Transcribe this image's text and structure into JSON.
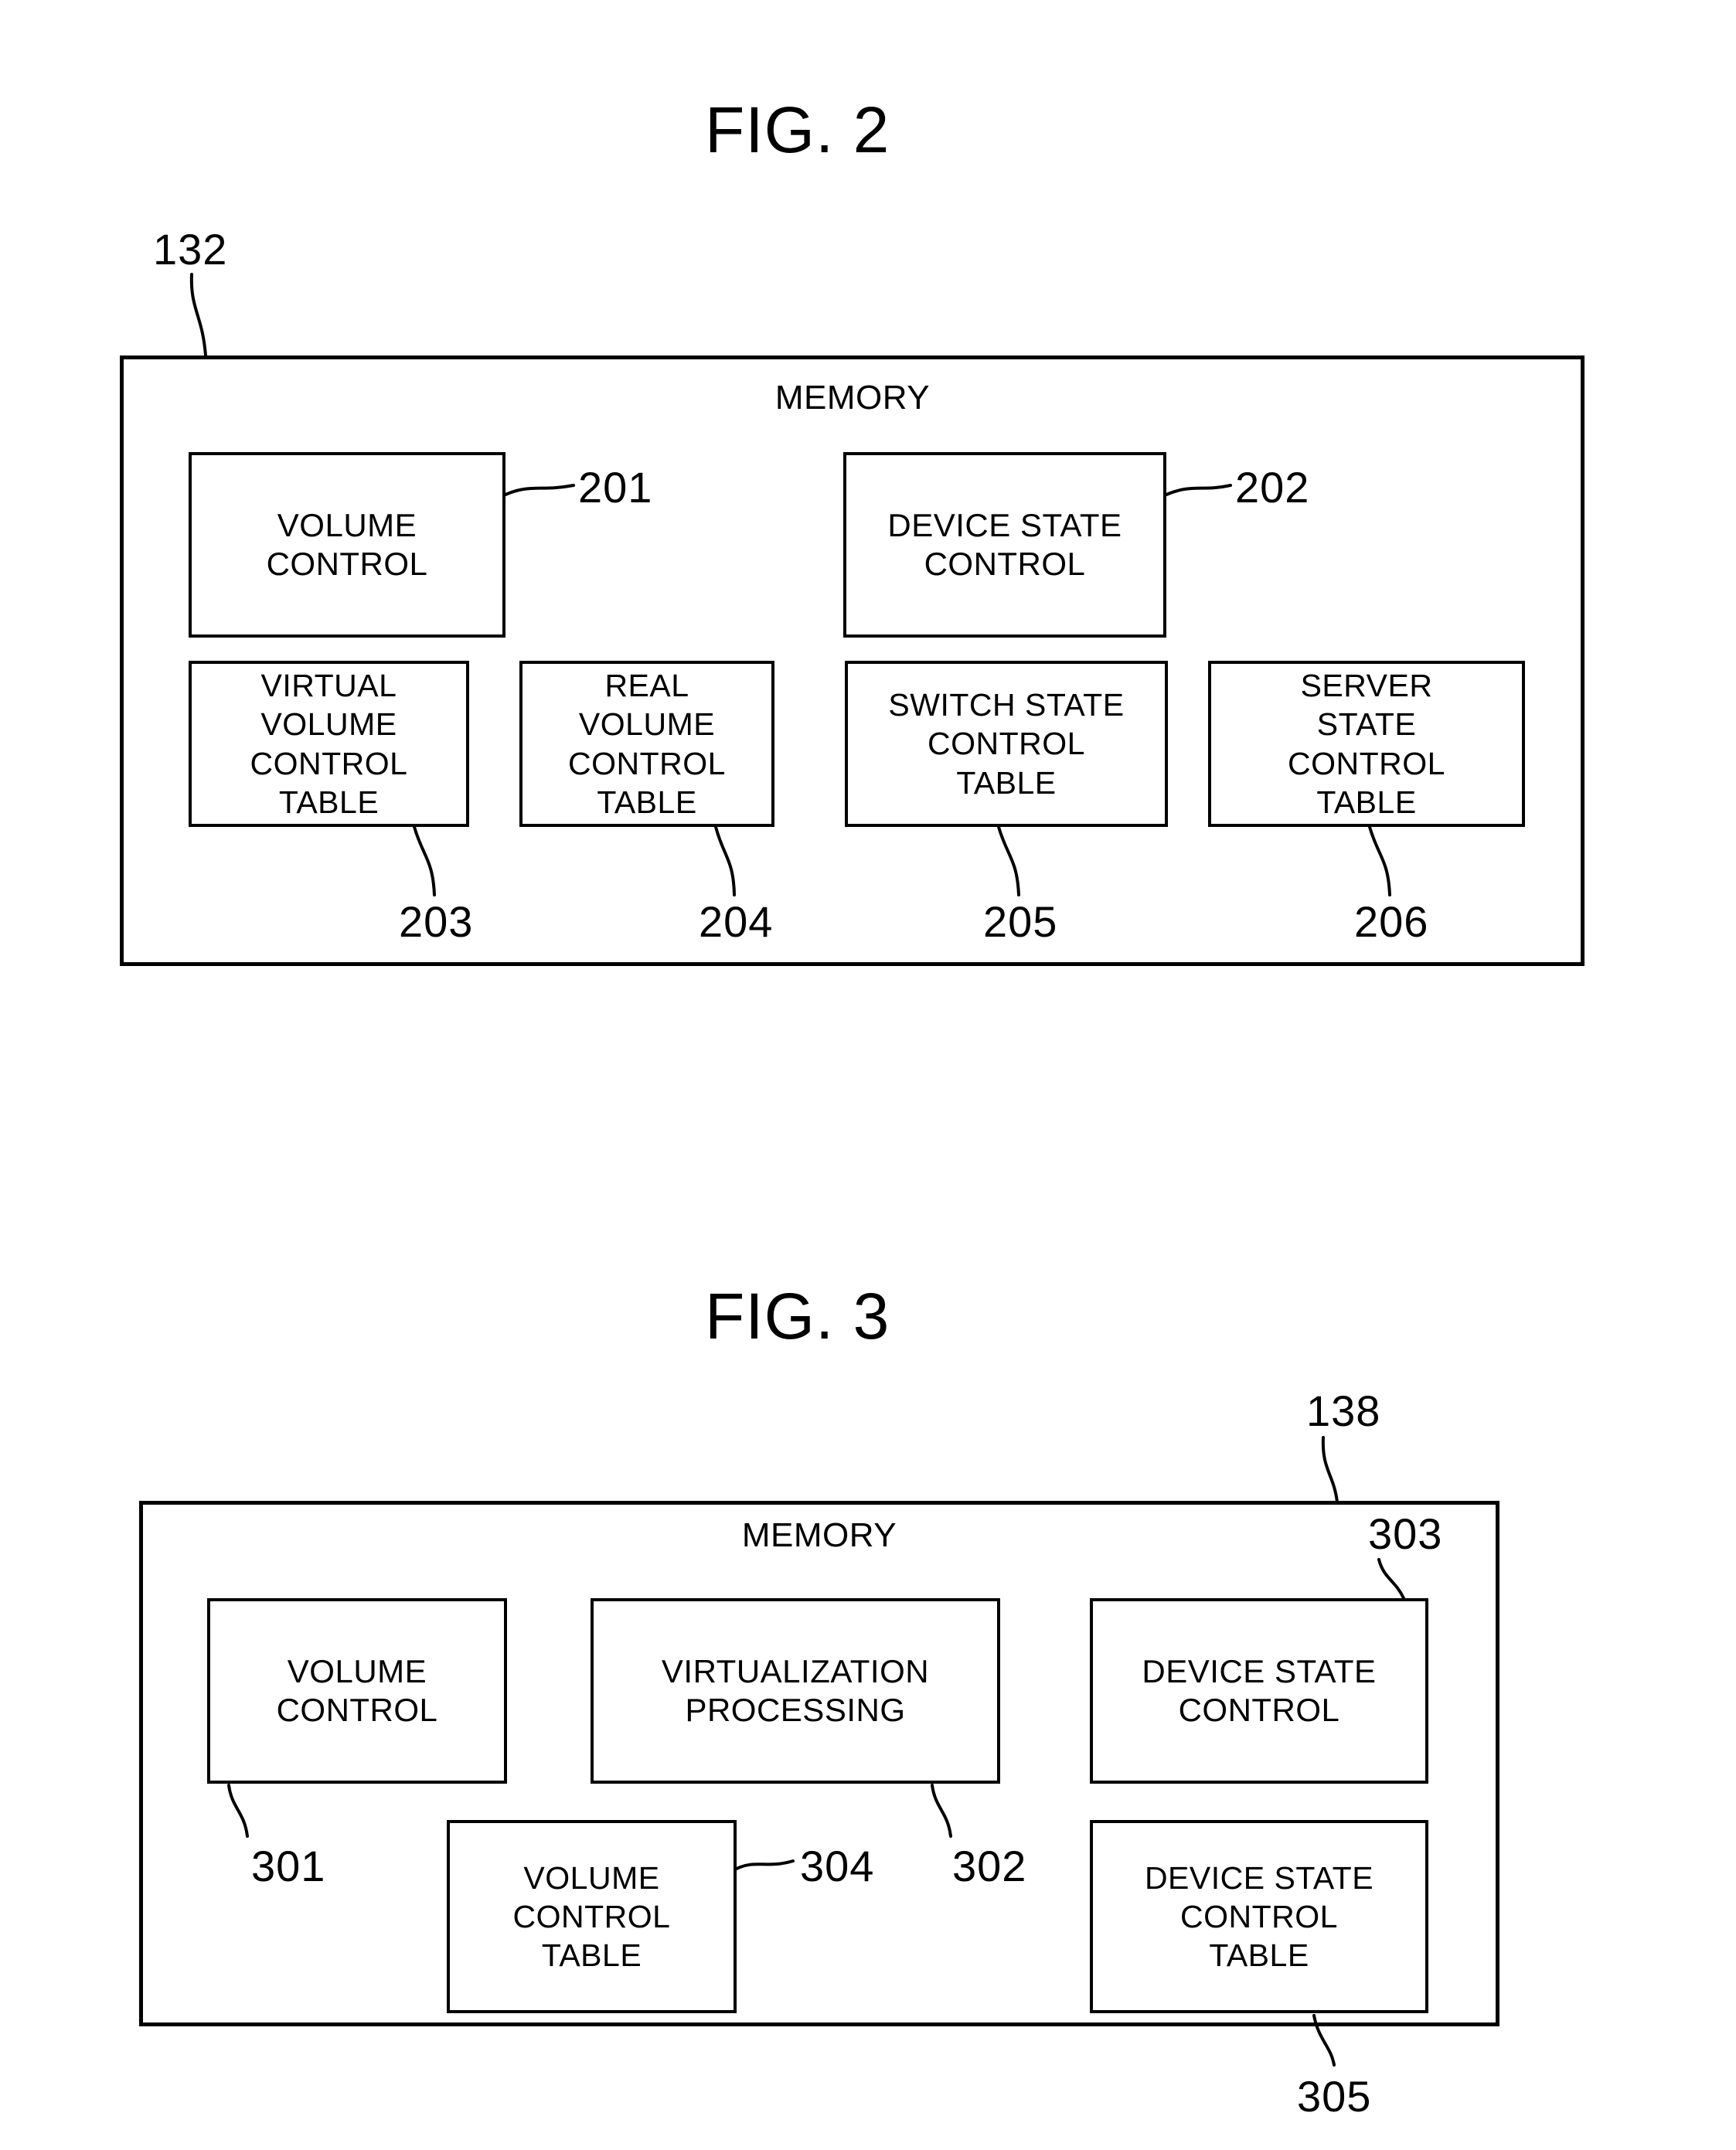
{
  "figures": [
    {
      "id": "fig2",
      "title": "FIG. 2",
      "frame_ref": "132",
      "frame_label": "MEMORY",
      "boxes": [
        {
          "id": "201",
          "label": "VOLUME\nCONTROL",
          "ref": "201"
        },
        {
          "id": "202",
          "label": "DEVICE  STATE\nCONTROL",
          "ref": "202"
        },
        {
          "id": "203",
          "label": "VIRTUAL\nVOLUME\nCONTROL\nTABLE",
          "ref": "203"
        },
        {
          "id": "204",
          "label": "REAL\nVOLUME\nCONTROL\nTABLE",
          "ref": "204"
        },
        {
          "id": "205",
          "label": "SWITCH STATE\nCONTROL\nTABLE",
          "ref": "205"
        },
        {
          "id": "206",
          "label": "SERVER\nSTATE\nCONTROL\nTABLE",
          "ref": "206"
        }
      ]
    },
    {
      "id": "fig3",
      "title": "FIG. 3",
      "frame_ref": "138",
      "frame_label": "MEMORY",
      "boxes": [
        {
          "id": "301",
          "label": "VOLUME\nCONTROL",
          "ref": "301"
        },
        {
          "id": "302",
          "label": "VIRTUALIZATION\nPROCESSING",
          "ref": "302"
        },
        {
          "id": "303",
          "label": "DEVICE  STATE\nCONTROL",
          "ref": "303"
        },
        {
          "id": "304",
          "label": "VOLUME\nCONTROL\nTABLE",
          "ref": "304"
        },
        {
          "id": "305",
          "label": "DEVICE  STATE\nCONTROL\nTABLE",
          "ref": "305"
        }
      ]
    }
  ],
  "fig2": {
    "title": "FIG. 2",
    "memory_label": "MEMORY",
    "ref_132": "132",
    "box_201": "VOLUME\nCONTROL",
    "box_202": "DEVICE  STATE\nCONTROL",
    "box_203": "VIRTUAL\nVOLUME\nCONTROL\nTABLE",
    "box_204": "REAL\nVOLUME\nCONTROL\nTABLE",
    "box_205": "SWITCH STATE\nCONTROL\nTABLE",
    "box_206": "SERVER\nSTATE\nCONTROL\nTABLE",
    "ref_201": "201",
    "ref_202": "202",
    "ref_203": "203",
    "ref_204": "204",
    "ref_205": "205",
    "ref_206": "206"
  },
  "fig3": {
    "title": "FIG. 3",
    "memory_label": "MEMORY",
    "ref_138": "138",
    "box_301": "VOLUME\nCONTROL",
    "box_302": "VIRTUALIZATION\nPROCESSING",
    "box_303": "DEVICE  STATE\nCONTROL",
    "box_304": "VOLUME\nCONTROL\nTABLE",
    "box_305": "DEVICE  STATE\nCONTROL\nTABLE",
    "ref_301": "301",
    "ref_302": "302",
    "ref_303": "303",
    "ref_304": "304",
    "ref_305": "305"
  },
  "colors": {
    "ink": "#000000",
    "paper": "#ffffff"
  }
}
